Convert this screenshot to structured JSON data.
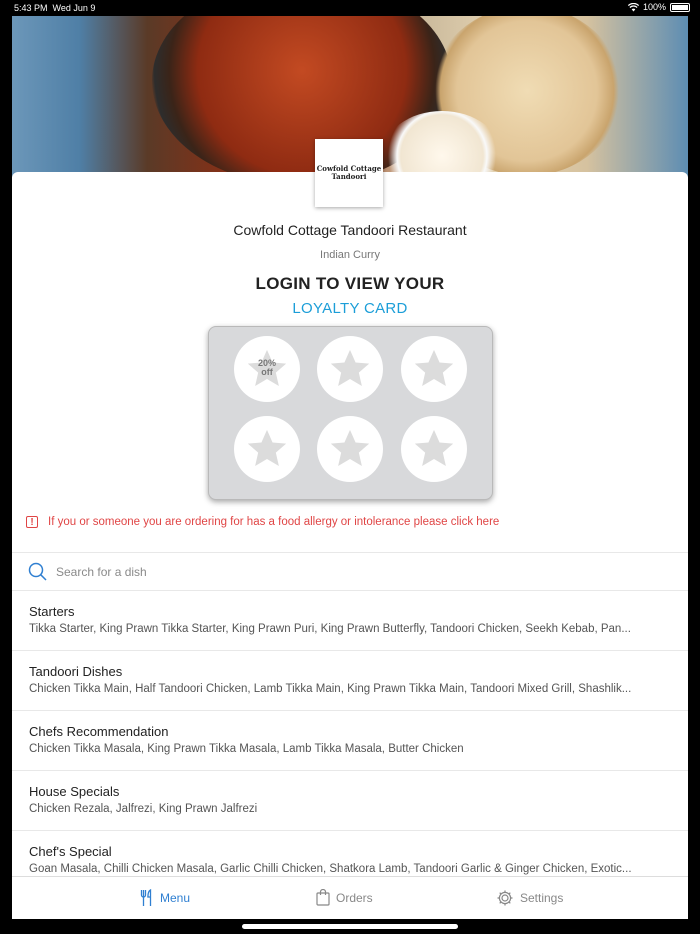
{
  "status": {
    "time": "5:43 PM",
    "date": "Wed Jun 9",
    "battery": "100%"
  },
  "restaurant": {
    "logo_line1": "Cowfold Cottage",
    "logo_line2": "Tandoori",
    "name": "Cowfold Cottage Tandoori Restaurant",
    "cuisine": "Indian Curry"
  },
  "loyalty": {
    "login_title": "LOGIN TO VIEW YOUR",
    "card_title": "LOYALTY CARD",
    "reward_line1": "20%",
    "reward_line2": "off"
  },
  "allergy_notice": "If you or someone you are ordering for has a food allergy or intolerance please click here",
  "search": {
    "placeholder": "Search for a dish"
  },
  "categories": [
    {
      "title": "Starters",
      "items": "Tikka Starter, King Prawn Tikka Starter, King Prawn Puri, King Prawn Butterfly, Tandoori Chicken, Seekh Kebab, Pan..."
    },
    {
      "title": "Tandoori Dishes",
      "items": "Chicken Tikka Main, Half Tandoori Chicken, Lamb Tikka Main, King Prawn Tikka Main, Tandoori Mixed Grill, Shashlik..."
    },
    {
      "title": "Chefs Recommendation",
      "items": "Chicken Tikka Masala, King Prawn Tikka Masala, Lamb Tikka Masala, Butter Chicken"
    },
    {
      "title": "House Specials",
      "items": "Chicken Rezala, Jalfrezi, King Prawn Jalfrezi"
    },
    {
      "title": "Chef's Special",
      "items": "Goan Masala, Chilli Chicken Masala, Garlic Chilli Chicken, Shatkora Lamb, Tandoori Garlic & Ginger Chicken, Exotic..."
    }
  ],
  "tabs": {
    "menu": "Menu",
    "orders": "Orders",
    "settings": "Settings"
  },
  "colors": {
    "accent": "#1c9ed8",
    "alert": "#e04545",
    "tab_active": "#2f7fd1"
  }
}
